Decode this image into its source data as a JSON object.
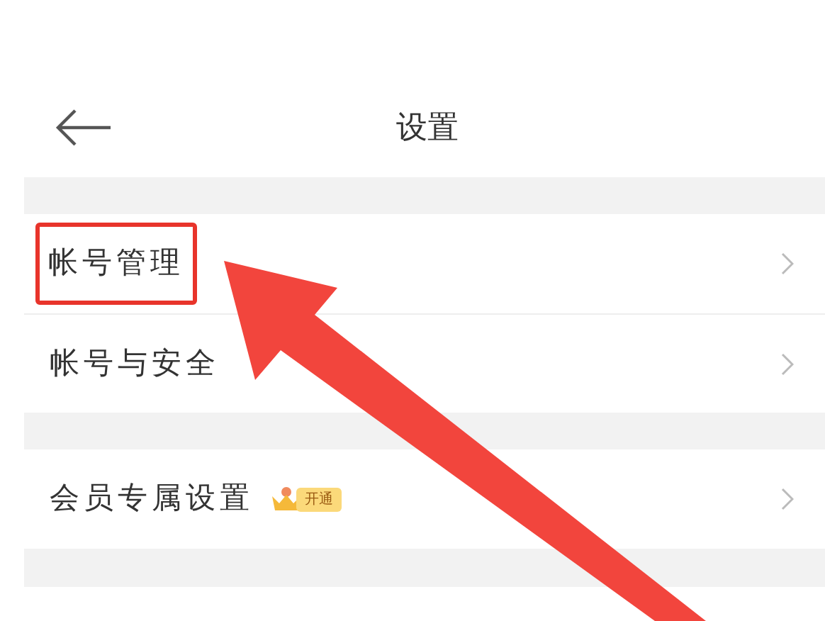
{
  "header": {
    "title": "设置"
  },
  "sections": [
    {
      "rows": [
        {
          "label": "帐号管理",
          "highlighted": true
        },
        {
          "label": "帐号与安全",
          "highlighted": false
        }
      ]
    },
    {
      "rows": [
        {
          "label": "会员专属设置",
          "highlighted": false,
          "badge": "开通"
        }
      ]
    }
  ]
}
